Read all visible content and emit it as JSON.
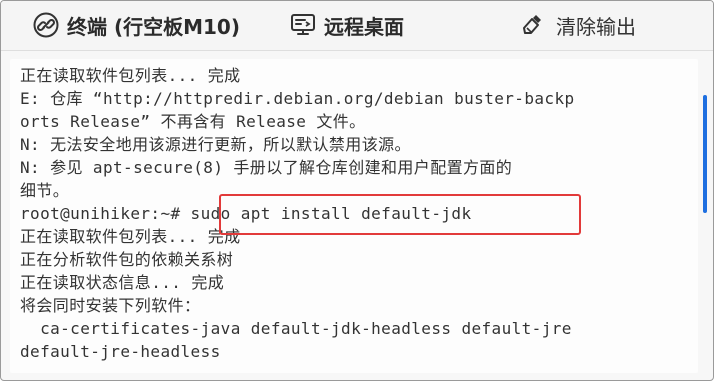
{
  "toolbar": {
    "terminal_label": "终端 (行空板M10)",
    "terminal_icon": "link-icon",
    "remote_label": "远程桌面",
    "remote_icon": "monitor-icon",
    "clear_label": "清除输出",
    "clear_icon": "eraser-icon"
  },
  "terminal": {
    "lines": [
      "正在读取软件包列表... 完成",
      "E: 仓库 “http://httpredir.debian.org/debian buster-backp",
      "orts Release” 不再含有 Release 文件。",
      "N: 无法安全地用该源进行更新，所以默认禁用该源。",
      "N: 参见 apt-secure(8) 手册以了解仓库创建和用户配置方面的",
      "细节。",
      "root@unihiker:~# sudo apt install default-jdk",
      "正在读取软件包列表... 完成",
      "正在分析软件包的依赖关系树",
      "正在读取状态信息... 完成",
      "将会同时安装下列软件：",
      "  ca-certificates-java default-jdk-headless default-jre",
      "default-jre-headless"
    ]
  },
  "colors": {
    "highlight": "#e23a3a",
    "scrollbar": "#1e6fe0"
  }
}
